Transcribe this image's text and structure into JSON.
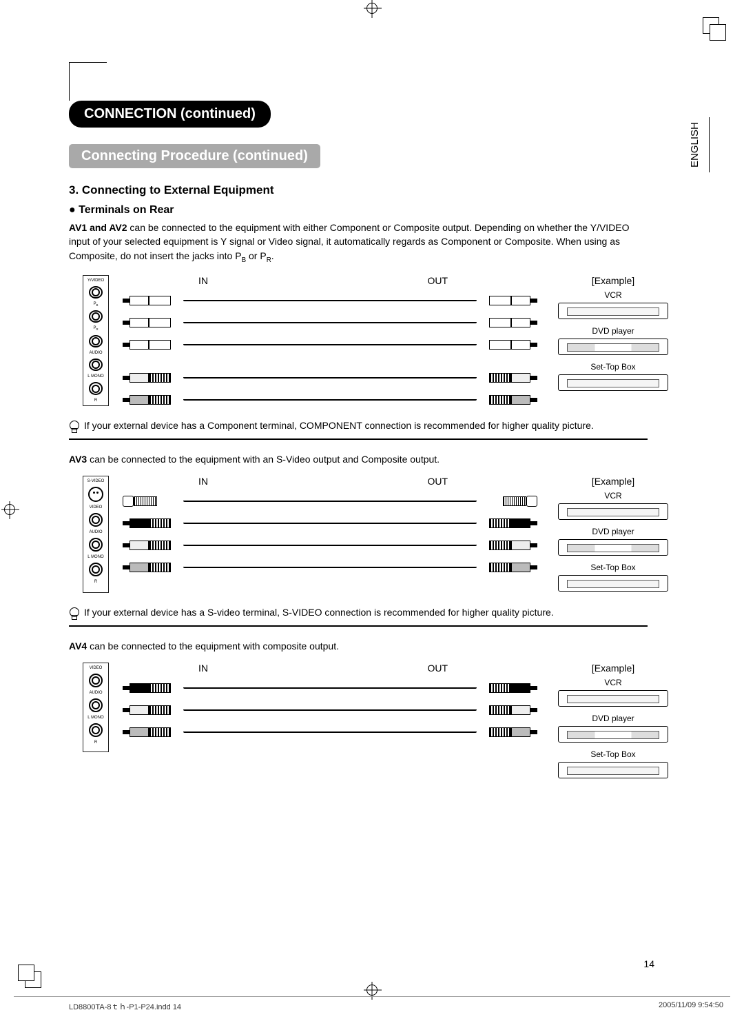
{
  "header": {
    "title": "CONNECTION (continued)",
    "subtitle": "Connecting Procedure (continued)",
    "section": "3. Connecting to External Equipment",
    "bullet": "● Terminals on Rear"
  },
  "language": "ENGLISH",
  "av12": {
    "lead_bold": "AV1 and AV2",
    "lead_rest": " can be connected to the equipment with either Component or Composite output. Depending on whether the Y/VIDEO input of your selected equipment is Y signal or Video signal, it automatically regards as Component or Composite. When using as Composite, do not insert the jacks into P",
    "lead_pb": "B",
    "lead_or": " or P",
    "lead_pr": "R",
    "lead_end": ".",
    "in": "IN",
    "out": "OUT",
    "example": "[Example]",
    "vcr": "VCR",
    "dvd": "DVD player",
    "stb": "Set-Top Box",
    "tip": "If your external device has a Component terminal, COMPONENT connection is recommended for higher quality picture.",
    "jacks": {
      "yvideo": "Y/VIDEO",
      "pb": "P",
      "pb_sub": "B",
      "pr": "P",
      "pr_sub": "R",
      "audio": "AUDIO",
      "l": "L",
      "mono": "MONO",
      "r": "R"
    }
  },
  "av3": {
    "lead_bold": "AV3",
    "lead_rest": " can be connected to the equipment with an S-Video output and Composite output.",
    "in": "IN",
    "out": "OUT",
    "example": "[Example]",
    "vcr": "VCR",
    "dvd": "DVD player",
    "stb": "Set-Top Box",
    "tip": "If your external device has a S-video terminal, S-VIDEO connection is recommended for higher quality picture.",
    "jacks": {
      "svideo": "S-VIDEO",
      "video": "VIDEO",
      "audio": "AUDIO",
      "l": "L",
      "mono": "MONO",
      "r": "R"
    }
  },
  "av4": {
    "lead_bold": "AV4",
    "lead_rest": " can be connected to the equipment with composite output.",
    "in": "IN",
    "out": "OUT",
    "example": "[Example]",
    "vcr": "VCR",
    "dvd": "DVD player",
    "stb": "Set-Top Box",
    "jacks": {
      "video": "VIDEO",
      "audio": "AUDIO",
      "l": "L",
      "mono": "MONO",
      "r": "R"
    }
  },
  "page_num": "14",
  "footer": {
    "file": "LD8800TA-8ｔｈ-P1-P24.indd   14",
    "date": "2005/11/09   9:54:50"
  }
}
